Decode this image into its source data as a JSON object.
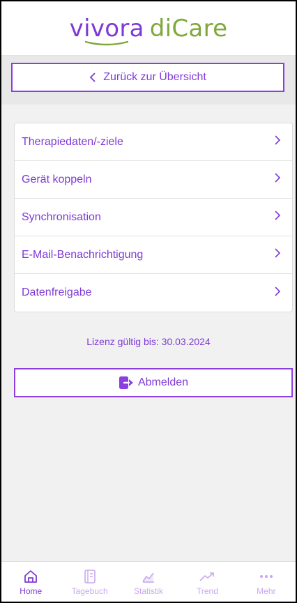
{
  "header": {
    "brand_part1": "vivora",
    "brand_part2": "diCare"
  },
  "back_button": {
    "label": "Zurück zur Übersicht"
  },
  "menu": {
    "items": [
      {
        "label": "Therapiedaten/-ziele"
      },
      {
        "label": "Gerät koppeln"
      },
      {
        "label": "Synchronisation"
      },
      {
        "label": "E-Mail-Benachrichtigung"
      },
      {
        "label": "Datenfreigabe"
      }
    ]
  },
  "license": {
    "text": "Lizenz gültig bis: 30.03.2024"
  },
  "logout": {
    "label": "Abmelden",
    "icon": "logout-icon"
  },
  "tabbar": {
    "tabs": [
      {
        "label": "Home",
        "icon": "home-icon",
        "active": true
      },
      {
        "label": "Tagebuch",
        "icon": "book-icon",
        "active": false
      },
      {
        "label": "Statistik",
        "icon": "chart-icon",
        "active": false
      },
      {
        "label": "Trend",
        "icon": "trend-icon",
        "active": false
      },
      {
        "label": "Mehr",
        "icon": "more-icon",
        "active": false
      }
    ]
  },
  "colors": {
    "accent": "#7e3ad6",
    "accent_light": "#c8a8ef",
    "brand_green": "#7fa83a"
  }
}
